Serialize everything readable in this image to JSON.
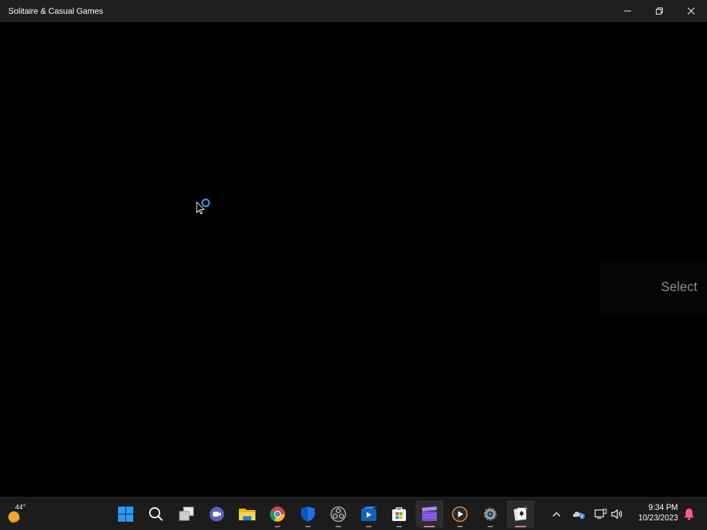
{
  "window": {
    "title": "Solitaire & Casual Games",
    "buttons": [
      "minimize",
      "restore",
      "close"
    ]
  },
  "game": {
    "select_text": "Select",
    "loading": true
  },
  "taskbar": {
    "weather": {
      "temperature": "44°",
      "icon": "sun-icon"
    },
    "apps": [
      {
        "name": "start",
        "icon": "windows-start-icon"
      },
      {
        "name": "search",
        "icon": "search-icon"
      },
      {
        "name": "task-view",
        "icon": "task-view-icon"
      },
      {
        "name": "teams-chat",
        "icon": "chat-icon"
      },
      {
        "name": "file-explorer",
        "icon": "folder-icon"
      },
      {
        "name": "chrome",
        "icon": "chrome-icon"
      },
      {
        "name": "defender",
        "icon": "shield-icon"
      },
      {
        "name": "obs",
        "icon": "obs-icon"
      },
      {
        "name": "clipchamp",
        "icon": "video-editor-icon"
      },
      {
        "name": "microsoft-store",
        "icon": "store-icon"
      },
      {
        "name": "clapperboard",
        "icon": "clapperboard-icon"
      },
      {
        "name": "media-player",
        "icon": "play-icon"
      },
      {
        "name": "settings",
        "icon": "gear-icon"
      },
      {
        "name": "solitaire",
        "icon": "solitaire-icon"
      }
    ],
    "tray": {
      "icons": [
        "chevron-up-icon",
        "onedrive-icon",
        "network-icon",
        "volume-icon"
      ],
      "time": "9:34 PM",
      "date": "10/23/2023",
      "notification_icon": "bell-icon"
    }
  },
  "colors": {
    "titlebar": "#202020",
    "background": "#000000",
    "taskbar": "#1c1c1c",
    "accent_blue": "#3a8ee6"
  }
}
